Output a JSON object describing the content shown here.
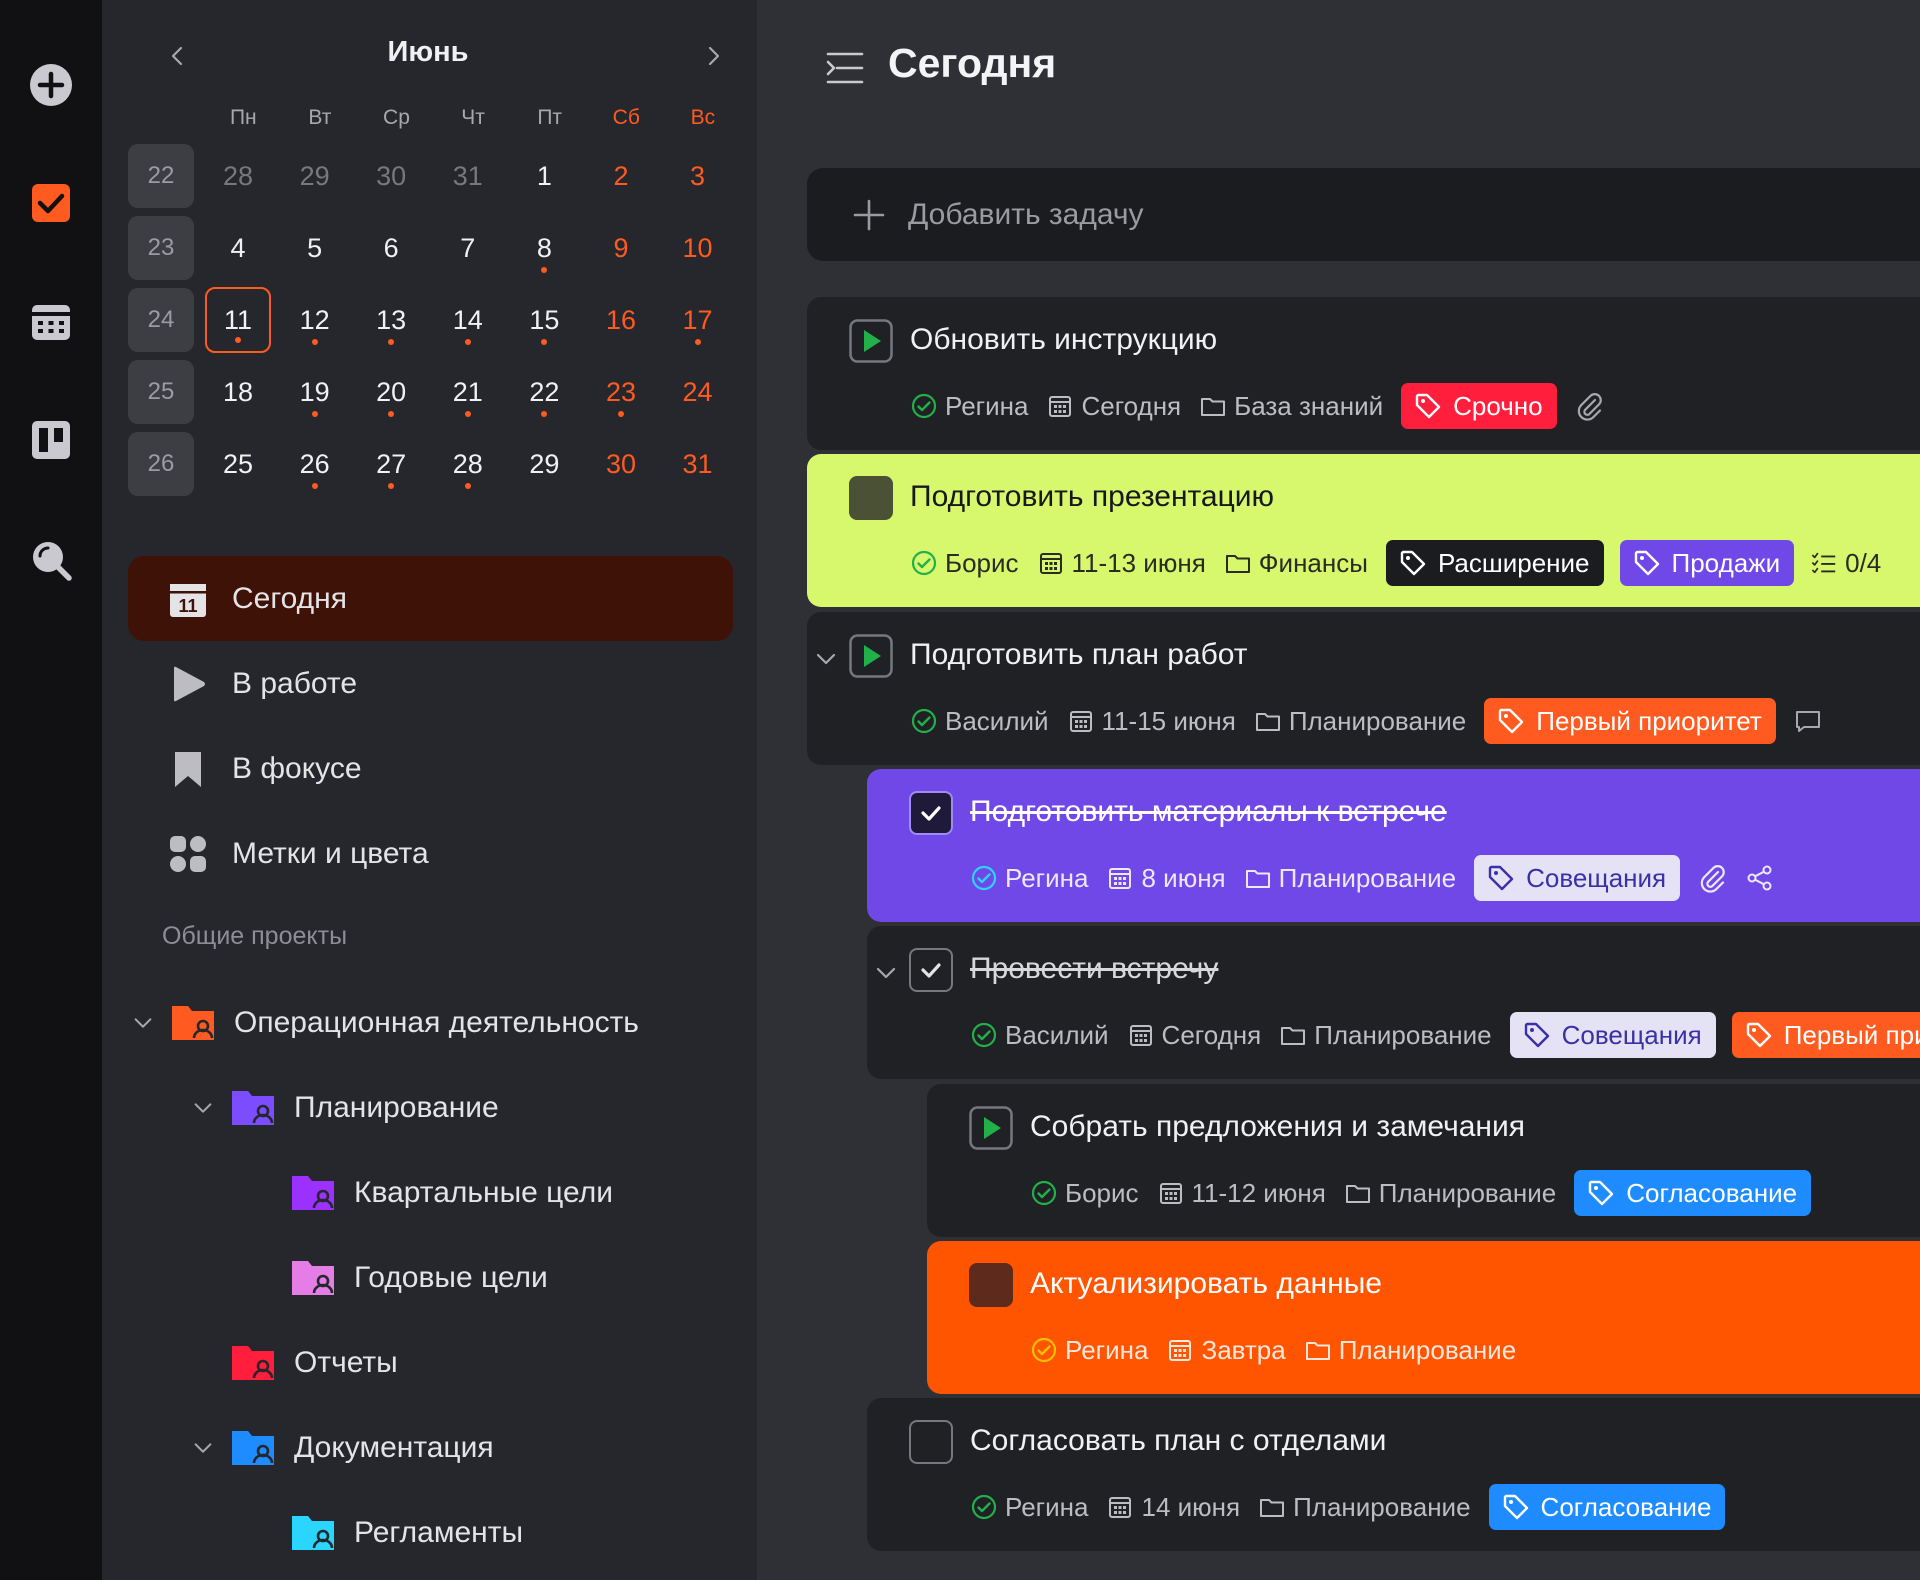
{
  "calendar": {
    "month": "Июнь",
    "weekdays": [
      "Пн",
      "Вт",
      "Ср",
      "Чт",
      "Пт",
      "Сб",
      "Вс"
    ],
    "weeks": [
      {
        "num": "22",
        "days": [
          {
            "d": "28",
            "muted": true
          },
          {
            "d": "29",
            "muted": true
          },
          {
            "d": "30",
            "muted": true
          },
          {
            "d": "31",
            "muted": true
          },
          {
            "d": "1"
          },
          {
            "d": "2",
            "weekend": true
          },
          {
            "d": "3",
            "weekend": true
          }
        ]
      },
      {
        "num": "23",
        "days": [
          {
            "d": "4"
          },
          {
            "d": "5"
          },
          {
            "d": "6"
          },
          {
            "d": "7"
          },
          {
            "d": "8",
            "dot": true
          },
          {
            "d": "9",
            "weekend": true
          },
          {
            "d": "10",
            "weekend": true
          }
        ]
      },
      {
        "num": "24",
        "days": [
          {
            "d": "11",
            "today": true,
            "dot": true
          },
          {
            "d": "12",
            "dot": true
          },
          {
            "d": "13",
            "dot": true
          },
          {
            "d": "14",
            "dot": true
          },
          {
            "d": "15",
            "dot": true
          },
          {
            "d": "16",
            "weekend": true
          },
          {
            "d": "17",
            "weekend": true,
            "dot": true
          }
        ]
      },
      {
        "num": "25",
        "days": [
          {
            "d": "18"
          },
          {
            "d": "19",
            "dot": true
          },
          {
            "d": "20",
            "dot": true
          },
          {
            "d": "21",
            "dot": true
          },
          {
            "d": "22",
            "dot": true
          },
          {
            "d": "23",
            "weekend": true,
            "dot": true
          },
          {
            "d": "24",
            "weekend": true
          }
        ]
      },
      {
        "num": "26",
        "days": [
          {
            "d": "25"
          },
          {
            "d": "26",
            "dot": true
          },
          {
            "d": "27",
            "dot": true
          },
          {
            "d": "28",
            "dot": true
          },
          {
            "d": "29"
          },
          {
            "d": "30",
            "weekend": true
          },
          {
            "d": "31",
            "weekend": true
          }
        ]
      }
    ]
  },
  "nav": {
    "today_icon_num": "11",
    "today": "Сегодня",
    "in_work": "В работе",
    "focus": "В фокусе",
    "tags": "Метки и цвета"
  },
  "projects": {
    "title": "Общие проекты",
    "items": [
      {
        "label": "Операционная деятельность",
        "color": "#ff5a1f"
      },
      {
        "label": "Планирование",
        "color": "#7c4dff"
      },
      {
        "label": "Квартальные цели",
        "color": "#9b30ff"
      },
      {
        "label": "Годовые цели",
        "color": "#e47ee6"
      },
      {
        "label": "Отчеты",
        "color": "#ff1e3c"
      },
      {
        "label": "Документация",
        "color": "#1e8bff"
      },
      {
        "label": "Регламенты",
        "color": "#2ad5ff"
      }
    ]
  },
  "main": {
    "title": "Сегодня",
    "add_task": "Добавить задачу"
  },
  "tasks": [
    {
      "title": "Обновить инструкцию",
      "user": "Регина",
      "date": "Сегодня",
      "project": "База знаний",
      "tags": [
        {
          "label": "Срочно",
          "bg": "#ff1e3c"
        }
      ]
    },
    {
      "title": "Подготовить презентацию",
      "user": "Борис",
      "date": "11-13 июня",
      "project": "Финансы",
      "tags": [
        {
          "label": "Расширение",
          "bg": "#1b1c20"
        },
        {
          "label": "Продажи",
          "bg": "#7048e8"
        }
      ],
      "checklist": "0/4"
    },
    {
      "title": "Подготовить план работ",
      "user": "Василий",
      "date": "11-15 июня",
      "project": "Планирование",
      "tags": [
        {
          "label": "Первый приоритет",
          "bg": "#ff5a1f"
        }
      ]
    },
    {
      "title": "Подготовить материалы к встрече",
      "user": "Регина",
      "date": "8 июня",
      "project": "Планирование",
      "tags": [
        {
          "label": "Совещания",
          "bg": "#e4e2f4"
        }
      ]
    },
    {
      "title": "Провести встречу",
      "user": "Василий",
      "date": "Сегодня",
      "project": "Планирование",
      "tags": [
        {
          "label": "Совещания",
          "bg": "#e4e2f4"
        },
        {
          "label": "Первый приоритет",
          "bg": "#ff5a1f"
        }
      ]
    },
    {
      "title": "Собрать предложения и замечания",
      "user": "Борис",
      "date": "11-12 июня",
      "project": "Планирование",
      "tags": [
        {
          "label": "Согласование",
          "bg": "#1e8bff"
        }
      ]
    },
    {
      "title": "Актуализировать данные",
      "user": "Регина",
      "date": "Завтра",
      "project": "Планирование",
      "tags": []
    },
    {
      "title": "Согласовать план с отделами",
      "user": "Регина",
      "date": "14 июня",
      "project": "Планирование",
      "tags": [
        {
          "label": "Согласование",
          "bg": "#1e8bff"
        }
      ]
    }
  ],
  "colors": {
    "accent": "#ff5a1f",
    "task_green": "#d7f76c",
    "task_purple": "#7048e8",
    "task_orange": "#ff5400",
    "task_dark": "#202125"
  }
}
